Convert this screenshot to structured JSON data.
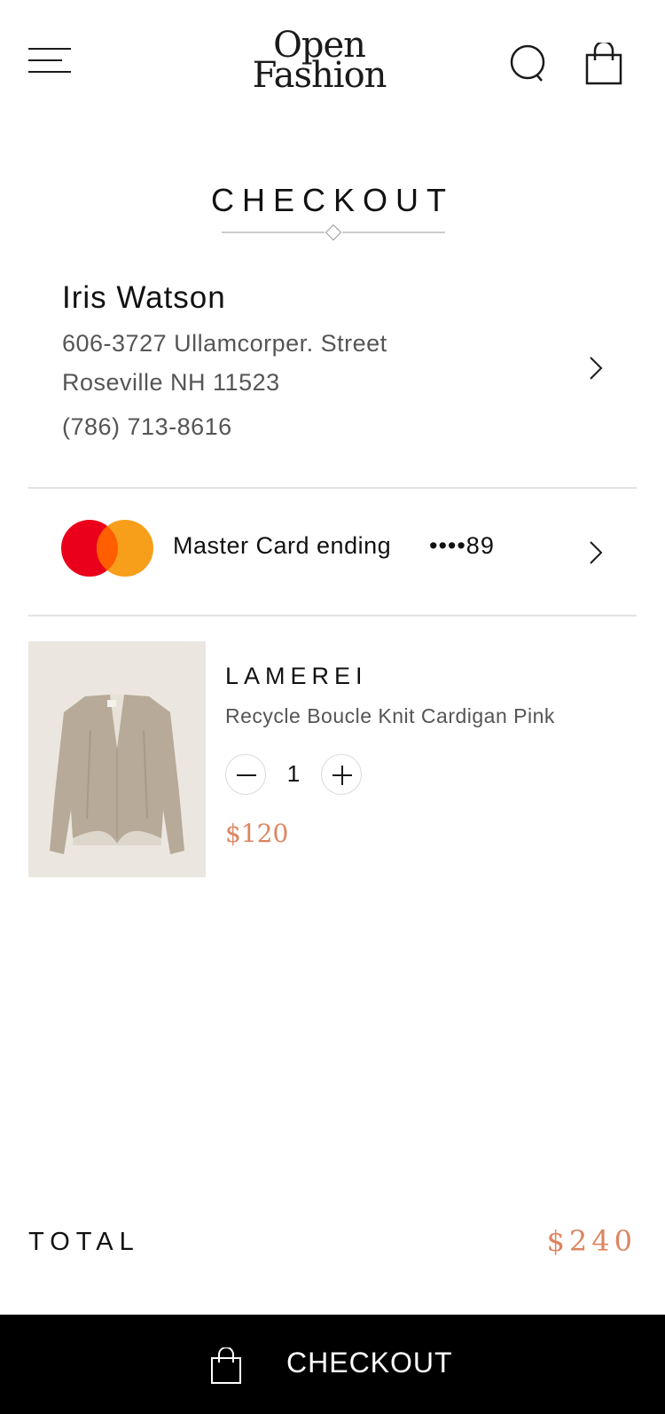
{
  "header": {
    "logo_line1": "Open",
    "logo_line2": "Fashion",
    "menu_icon": "menu-icon",
    "search_icon": "search-icon",
    "bag_icon": "shopping-bag-icon"
  },
  "page": {
    "title": "CHECKOUT"
  },
  "address": {
    "name": "Iris Watson",
    "line1": "606-3727 Ullamcorper. Street",
    "line2": "Roseville NH 11523",
    "phone": "(786) 713-8616"
  },
  "payment": {
    "label": "Master Card ending",
    "card_number": "••••89",
    "colors": {
      "red": "#eb001b",
      "orange": "#f79e1b",
      "overlap": "#ff5f00"
    }
  },
  "cart": {
    "items": [
      {
        "brand": "LAMEREI",
        "name": "Recycle Boucle Knit Cardigan Pink",
        "quantity": "1",
        "price": "$120"
      }
    ]
  },
  "summary": {
    "total_label": "TOTAL",
    "total_value": "$240"
  },
  "checkout_button": {
    "label": "CHECKOUT"
  },
  "theme": {
    "accent": "#dd8560",
    "text": "#111111",
    "divider": "#e2e2e2",
    "button_bg": "#000000"
  }
}
